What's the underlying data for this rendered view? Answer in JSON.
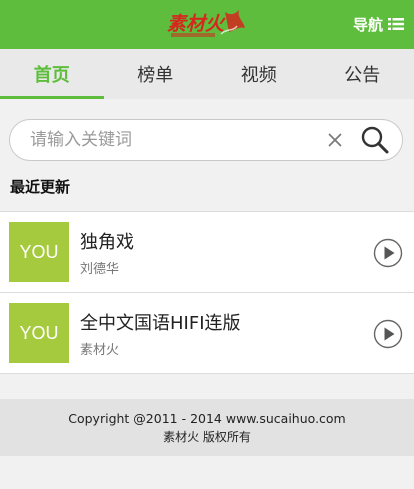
{
  "header": {
    "logo_text": "素材火",
    "nav_label": "导航"
  },
  "tabs": [
    {
      "label": "首页",
      "active": true
    },
    {
      "label": "榜单",
      "active": false
    },
    {
      "label": "视频",
      "active": false
    },
    {
      "label": "公告",
      "active": false
    }
  ],
  "search": {
    "placeholder": "请输入关键词",
    "value": ""
  },
  "section_title": "最近更新",
  "songs": [
    {
      "thumb": "YOU",
      "title": "独角戏",
      "artist": "刘德华"
    },
    {
      "thumb": "YOU",
      "title": "全中文国语HIFI连版",
      "artist": "素材火"
    }
  ],
  "footer": {
    "copyright": "Copyright @2011 - 2014 www.sucaihuo.com",
    "rights": "素材火 版权所有"
  },
  "colors": {
    "brand_green": "#5ebd3c",
    "thumb_green": "#a6ca3e",
    "logo_red": "#d4281e"
  }
}
